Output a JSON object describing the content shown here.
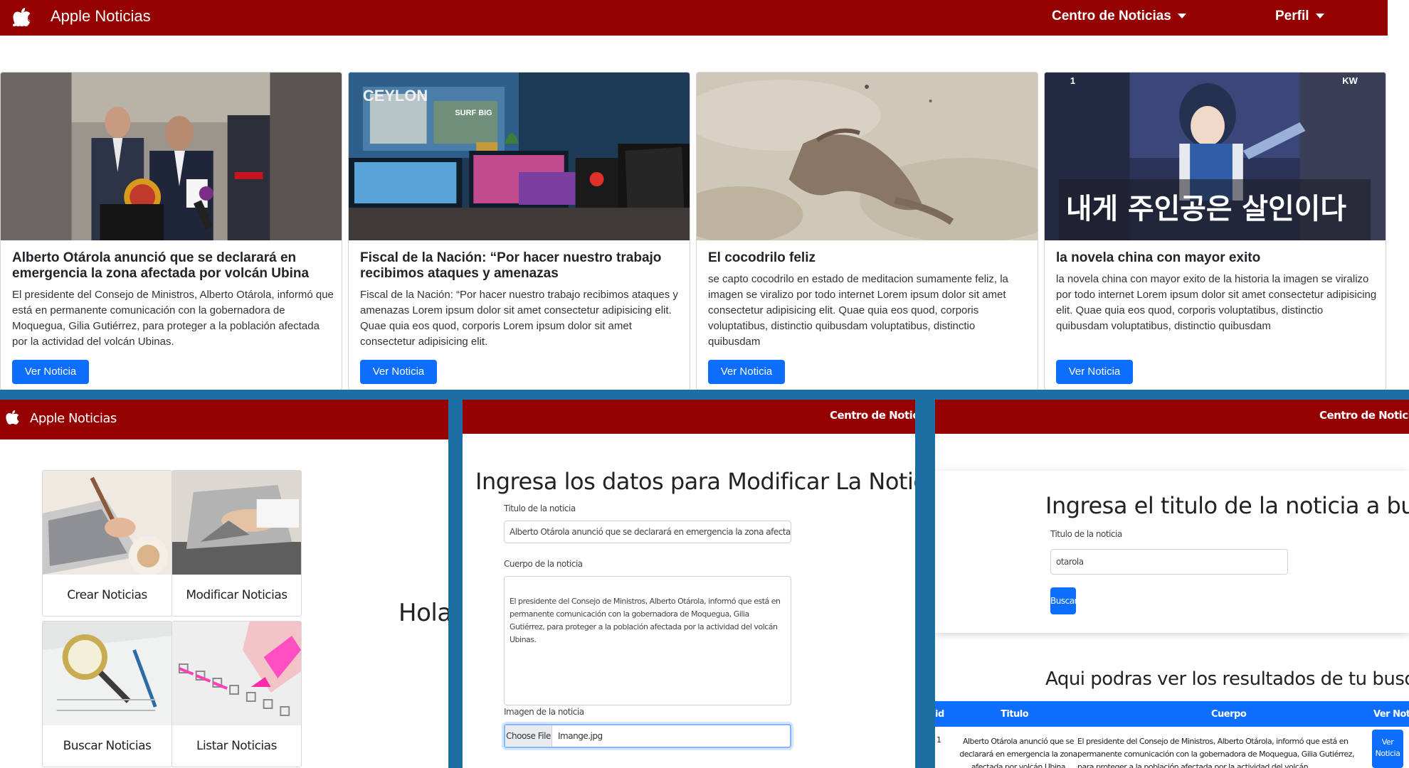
{
  "app": {
    "brand": "Apple Noticias"
  },
  "nav": {
    "centro": "Centro de Noticias",
    "perfil": "Perfil"
  },
  "cards": [
    {
      "title": "Alberto Otárola anunció que se declarará en emergencia la zona afectada por volcán Ubina",
      "body": "El presidente del Consejo de Ministros, Alberto Otárola, informó que está en permanente comunicación con la gobernadora de Moquegua, Gilia Gutiérrez, para proteger a la población afectada por la actividad del volcán Ubinas.",
      "button": "Ver Noticia"
    },
    {
      "title": "Fiscal de la Nación: “Por hacer nuestro trabajo recibimos ataques y amenazas",
      "body": "Fiscal de la Nación: “Por hacer nuestro trabajo recibimos ataques y amenazas Lorem ipsum dolor sit amet consectetur adipisicing elit. Quae quia eos quod, corporis Lorem ipsum dolor sit amet consectetur adipisicing elit.",
      "button": "Ver Noticia"
    },
    {
      "title": "El cocodrilo feliz",
      "body": "se capto cocodrilo en estado de meditacion sumamente feliz, la imagen se viralizo por todo internet Lorem ipsum dolor sit amet consectetur adipisicing elit. Quae quia eos quod, corporis voluptatibus, distinctio quibusdam voluptatibus, distinctio quibusdam",
      "button": "Ver Noticia"
    },
    {
      "title": "la novela china con mayor exito",
      "body": "la novela china con mayor exito de la historia la imagen se viralizo por todo internet Lorem ipsum dolor sit amet consectetur adipisicing elit. Quae quia eos quod, corporis voluptatibus, distinctio quibusdam voluptatibus, distinctio quibusdam",
      "button": "Ver Noticia"
    }
  ],
  "card_image_text": {
    "ceylon": "CEYLON",
    "surf": "SURF BIG",
    "kw": "KW",
    "manhwa_no": "1",
    "korean": "내게 주인공은 살인이다"
  },
  "menu": {
    "crear": "Crear Noticias",
    "modificar": "Modificar Noticias",
    "buscar": "Buscar Noticias",
    "listar": "Listar Noticias",
    "greeting": "Hola c"
  },
  "modify": {
    "heading": "Ingresa los datos para Modificar La Noticia",
    "title_label": "Titulo de la noticia",
    "title_value": "Alberto Otárola anunció que se declarará en emergencia la zona afectada por volcán Ub",
    "body_label": "Cuerpo de la noticia",
    "body_value": "El presidente del Consejo de Ministros, Alberto Otárola, informó que está en permanente comunicación con la gobernadora de Moquegua, Gilia Gutiérrez, para proteger a la población afectada por la actividad del volcán Ubinas.",
    "image_label": "Imagen de la noticia",
    "choose_file": "Choose File",
    "file_name": "Imange.jpg"
  },
  "search": {
    "heading": "Ingresa el titulo de la noticia a buscar",
    "label": "Titulo de la noticia",
    "value": "otarola",
    "button": "Buscar",
    "results_heading": "Aqui podras ver los resultados de tu busqueda",
    "columns": [
      "id",
      "Titulo",
      "Cuerpo",
      "Ver Noticia"
    ],
    "rows": [
      {
        "id": "1",
        "titulo": "Alberto Otárola anunció que se declarará en emergencia la zona afectada por volcán Ubina",
        "cuerpo": "El presidente del Consejo de Ministros, Alberto Otárola, informó que está en permanente comunicación con la gobernadora de Moquegua, Gilia Gutiérrez, para proteger a la población afectada por la actividad del volcán",
        "button": "Ver Noticia"
      }
    ]
  },
  "colors": {
    "navbar": "#950000",
    "primary": "#0d6efd",
    "frame": "#1d6ea3"
  }
}
